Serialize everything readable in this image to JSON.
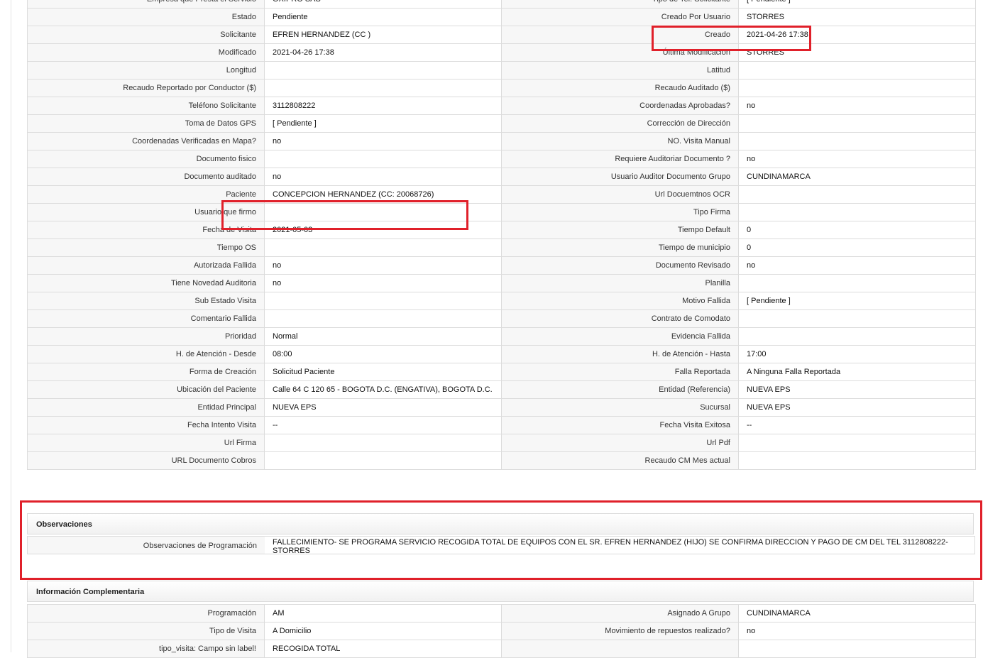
{
  "main_rows": [
    {
      "l1": "Empresa que Presta el Servicio",
      "v1": "OXIPRO SAS",
      "l2": "Tipo de Tel. Solicitante",
      "v2": "[ Pendiente ]"
    },
    {
      "l1": "Estado",
      "v1": "Pendiente",
      "l2": "Creado Por Usuario",
      "v2": "STORRES"
    },
    {
      "l1": "Solicitante",
      "v1": "EFREN HERNANDEZ (CC )",
      "l2": "Creado",
      "v2": "2021-04-26 17:38"
    },
    {
      "l1": "Modificado",
      "v1": "2021-04-26 17:38",
      "l2": "Última Modificación",
      "v2": " STORRES"
    },
    {
      "l1": "Longitud",
      "v1": "",
      "l2": "Latitud",
      "v2": ""
    },
    {
      "l1": "Recaudo Reportado por Conductor ($)",
      "v1": "",
      "l2": "Recaudo Auditado ($)",
      "v2": ""
    },
    {
      "l1": "Teléfono Solicitante",
      "v1": "3112808222",
      "l2": "Coordenadas Aprobadas?",
      "v2": " no"
    },
    {
      "l1": "Toma de Datos GPS",
      "v1": "[ Pendiente ]",
      "l2": "Corrección de Dirección",
      "v2": ""
    },
    {
      "l1": "Coordenadas Verificadas en Mapa?",
      "v1": " no",
      "l2": "NO. Visita Manual",
      "v2": ""
    },
    {
      "l1": "Documento fisico",
      "v1": "",
      "l2": "Requiere Auditoriar Documento ?",
      "v2": " no"
    },
    {
      "l1": "Documento auditado",
      "v1": " no",
      "l2": "Usuario Auditor Documento Grupo",
      "v2": "CUNDINAMARCA"
    },
    {
      "l1": "Paciente",
      "v1": "CONCEPCION HERNANDEZ (CC: 20068726)",
      "l2": "Url Docuemtnos OCR",
      "v2": ""
    },
    {
      "l1": "Usuario que firmo",
      "v1": "",
      "l2": "Tipo Firma",
      "v2": ""
    },
    {
      "l1": "Fecha de Visita",
      "v1": " 2021-05-03",
      "l2": "Tiempo Default",
      "v2": "0"
    },
    {
      "l1": "Tiempo OS",
      "v1": "",
      "l2": "Tiempo de municipio",
      "v2": "0"
    },
    {
      "l1": "Autorizada Fallida",
      "v1": " no",
      "l2": "Documento Revisado",
      "v2": " no"
    },
    {
      "l1": "Tiene Novedad Auditoria",
      "v1": " no",
      "l2": "Planilla",
      "v2": ""
    },
    {
      "l1": "Sub Estado Visita",
      "v1": "",
      "l2": "Motivo Fallida",
      "v2": "[ Pendiente ]"
    },
    {
      "l1": "Comentario Fallida",
      "v1": "",
      "l2": "Contrato de Comodato",
      "v2": ""
    },
    {
      "l1": "Prioridad",
      "v1": "Normal",
      "l2": "Evidencia Fallida",
      "v2": ""
    },
    {
      "l1": "H. de Atención - Desde",
      "v1": "08:00",
      "l2": "H. de Atención - Hasta",
      "v2": "17:00"
    },
    {
      "l1": "Forma de Creación",
      "v1": "Solicitud Paciente",
      "l2": "Falla Reportada",
      "v2": "A Ninguna Falla Reportada"
    },
    {
      "l1": "Ubicación del Paciente",
      "v1": "Calle 64 C 120 65 - BOGOTA D.C. (ENGATIVA), BOGOTA D.C.",
      "l2": "Entidad (Referencia)",
      "v2": "NUEVA EPS"
    },
    {
      "l1": "Entidad Principal",
      "v1": "NUEVA EPS",
      "l2": "Sucursal",
      "v2": "NUEVA EPS"
    },
    {
      "l1": "Fecha Intento Visita",
      "v1": " --",
      "l2": "Fecha Visita Exitosa",
      "v2": " --"
    },
    {
      "l1": "Url Firma",
      "v1": "",
      "l2": "Url Pdf",
      "v2": ""
    },
    {
      "l1": "URL Documento Cobros",
      "v1": "",
      "l2": "Recaudo CM Mes actual",
      "v2": ""
    }
  ],
  "observaciones": {
    "title": "Observaciones",
    "label": "Observaciones de Programación",
    "value": " FALLECIMIENTO- SE PROGRAMA SERVICIO RECOGIDA TOTAL DE EQUIPOS CON EL SR. EFREN HERNANDEZ (HIJO) SE CONFIRMA DIRECCION Y PAGO DE CM DEL TEL 3112808222- STORRES"
  },
  "complementaria": {
    "title": "Información Complementaria",
    "rows": [
      {
        "l1": "Programación",
        "v1": "AM",
        "l2": "Asignado A Grupo",
        "v2": "CUNDINAMARCA"
      },
      {
        "l1": "Tipo de Visita",
        "v1": "A Domicilio",
        "l2": "Movimiento de repuestos realizado?",
        "v2": " no"
      },
      {
        "l1": "tipo_visita: Campo sin label!",
        "v1": "RECOGIDA TOTAL",
        "l2": "",
        "v2": ""
      }
    ]
  },
  "highlight_color": "#e0202a"
}
